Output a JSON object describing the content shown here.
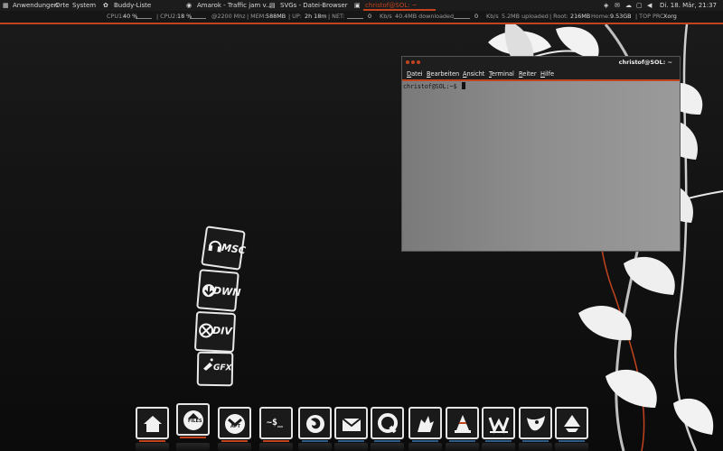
{
  "top_panel": {
    "menus": [
      "Anwendungen",
      "Orte",
      "System"
    ],
    "tasks": [
      {
        "label": "Buddy-Liste",
        "active": false
      },
      {
        "label": "Amarok - Traffic jam v...",
        "active": false
      },
      {
        "label": "SVGs - Datei-Browser",
        "active": false
      },
      {
        "label": "christof@SOL: ~",
        "active": true
      }
    ],
    "clock": "Di. 18. Mär, 21:37"
  },
  "conky": {
    "cpu1_label": "CPU1:",
    "cpu1_value": "40 %",
    "cpu2_label": "| CPU2:",
    "cpu2_value": "18 %",
    "freq": "@2200 Mhz",
    "mem_label": "| MEM:",
    "mem_value": "588MB",
    "up_label": "| UP:",
    "up_value": "2h 18m",
    "net_label": "| NET:",
    "down_rate": "0",
    "down_unit": "Kb/s",
    "downloaded": "40.4MB downloaded",
    "up_rate": "0",
    "up_unit": "Kb/s",
    "uploaded": "5.2MB uploaded",
    "root_label": "| Root:",
    "root_value": "216MB",
    "home_label": "Home:",
    "home_value": "9.53GB",
    "top_label": "| TOP PRC",
    "top_value": "Xorg"
  },
  "terminal": {
    "title": "christof@SOL: ~",
    "menus": [
      {
        "first": "D",
        "rest": "atei"
      },
      {
        "first": "B",
        "rest": "earbeiten"
      },
      {
        "first": "A",
        "rest": "nsicht"
      },
      {
        "first": "T",
        "rest": "erminal"
      },
      {
        "first": "R",
        "rest": "eiter"
      },
      {
        "first": "H",
        "rest": "ilfe"
      }
    ],
    "prompt": "christof@SOL:~$"
  },
  "stack_icons": [
    {
      "label": "MSC"
    },
    {
      "label": "DWN"
    },
    {
      "label": "DIV"
    },
    {
      "label": "GFX"
    }
  ],
  "dock": [
    {
      "icon": "home-icon"
    },
    {
      "icon": "files-icon",
      "label": "FILES"
    },
    {
      "icon": "apt-icon",
      "label": "APT"
    },
    {
      "icon": "terminal-icon",
      "label": "~$_"
    },
    {
      "icon": "firefox-icon"
    },
    {
      "icon": "mail-icon"
    },
    {
      "icon": "quicktime-icon"
    },
    {
      "icon": "wolf-icon"
    },
    {
      "icon": "vlc-icon"
    },
    {
      "icon": "writer-icon"
    },
    {
      "icon": "gimp-icon"
    },
    {
      "icon": "inkscape-icon"
    }
  ],
  "colors": {
    "accent": "#c1441e",
    "blue": "#2f5d8a"
  }
}
